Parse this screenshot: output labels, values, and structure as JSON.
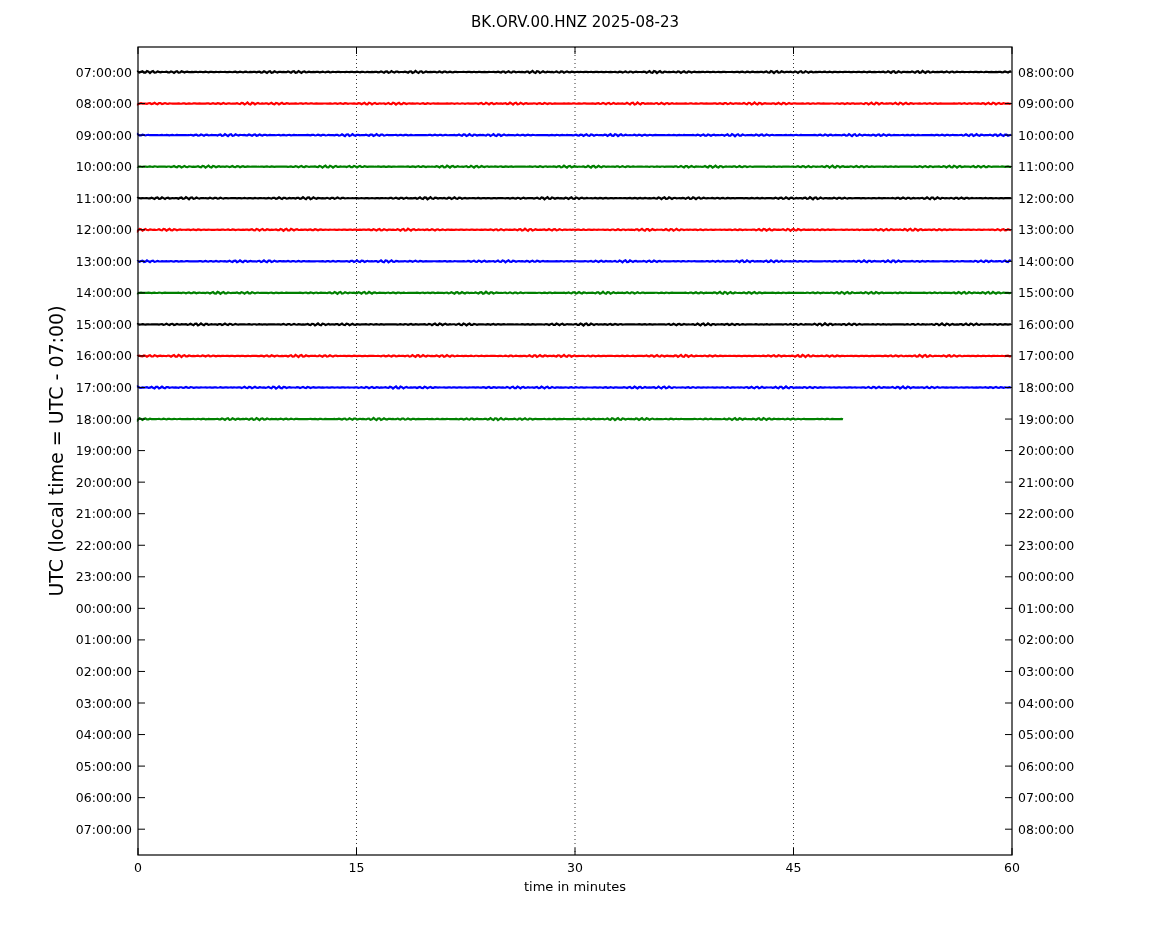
{
  "plot": {
    "title": "BK.ORV.00.HNZ 2025-08-23",
    "x_axis_label": "time in minutes",
    "y_axis_label": "UTC (local time = UTC - 07:00)",
    "x_tick_labels": [
      "0",
      "15",
      "30",
      "45",
      "60"
    ],
    "left_tick_labels": [
      "07:00:00",
      "08:00:00",
      "09:00:00",
      "10:00:00",
      "11:00:00",
      "12:00:00",
      "13:00:00",
      "14:00:00",
      "15:00:00",
      "16:00:00",
      "17:00:00",
      "18:00:00",
      "19:00:00",
      "20:00:00",
      "21:00:00",
      "22:00:00",
      "23:00:00",
      "00:00:00",
      "01:00:00",
      "02:00:00",
      "03:00:00",
      "04:00:00",
      "05:00:00",
      "06:00:00",
      "07:00:00"
    ],
    "right_tick_labels": [
      "08:00:00",
      "09:00:00",
      "10:00:00",
      "11:00:00",
      "12:00:00",
      "13:00:00",
      "14:00:00",
      "15:00:00",
      "16:00:00",
      "17:00:00",
      "18:00:00",
      "19:00:00",
      "20:00:00",
      "21:00:00",
      "22:00:00",
      "23:00:00",
      "00:00:00",
      "01:00:00",
      "02:00:00",
      "03:00:00",
      "04:00:00",
      "05:00:00",
      "06:00:00",
      "07:00:00",
      "08:00:00"
    ],
    "traces": [
      {
        "color": "#000000",
        "kind": "full"
      },
      {
        "color": "#ff0000",
        "kind": "full"
      },
      {
        "color": "#0000ff",
        "kind": "full"
      },
      {
        "color": "#008000",
        "kind": "full"
      },
      {
        "color": "#000000",
        "kind": "full"
      },
      {
        "color": "#ff0000",
        "kind": "full"
      },
      {
        "color": "#0000ff",
        "kind": "full"
      },
      {
        "color": "#008000",
        "kind": "full"
      },
      {
        "color": "#000000",
        "kind": "full"
      },
      {
        "color": "#ff0000",
        "kind": "full"
      },
      {
        "color": "#0000ff",
        "kind": "full"
      },
      {
        "color": "#008000",
        "kind": "partial"
      }
    ]
  }
}
